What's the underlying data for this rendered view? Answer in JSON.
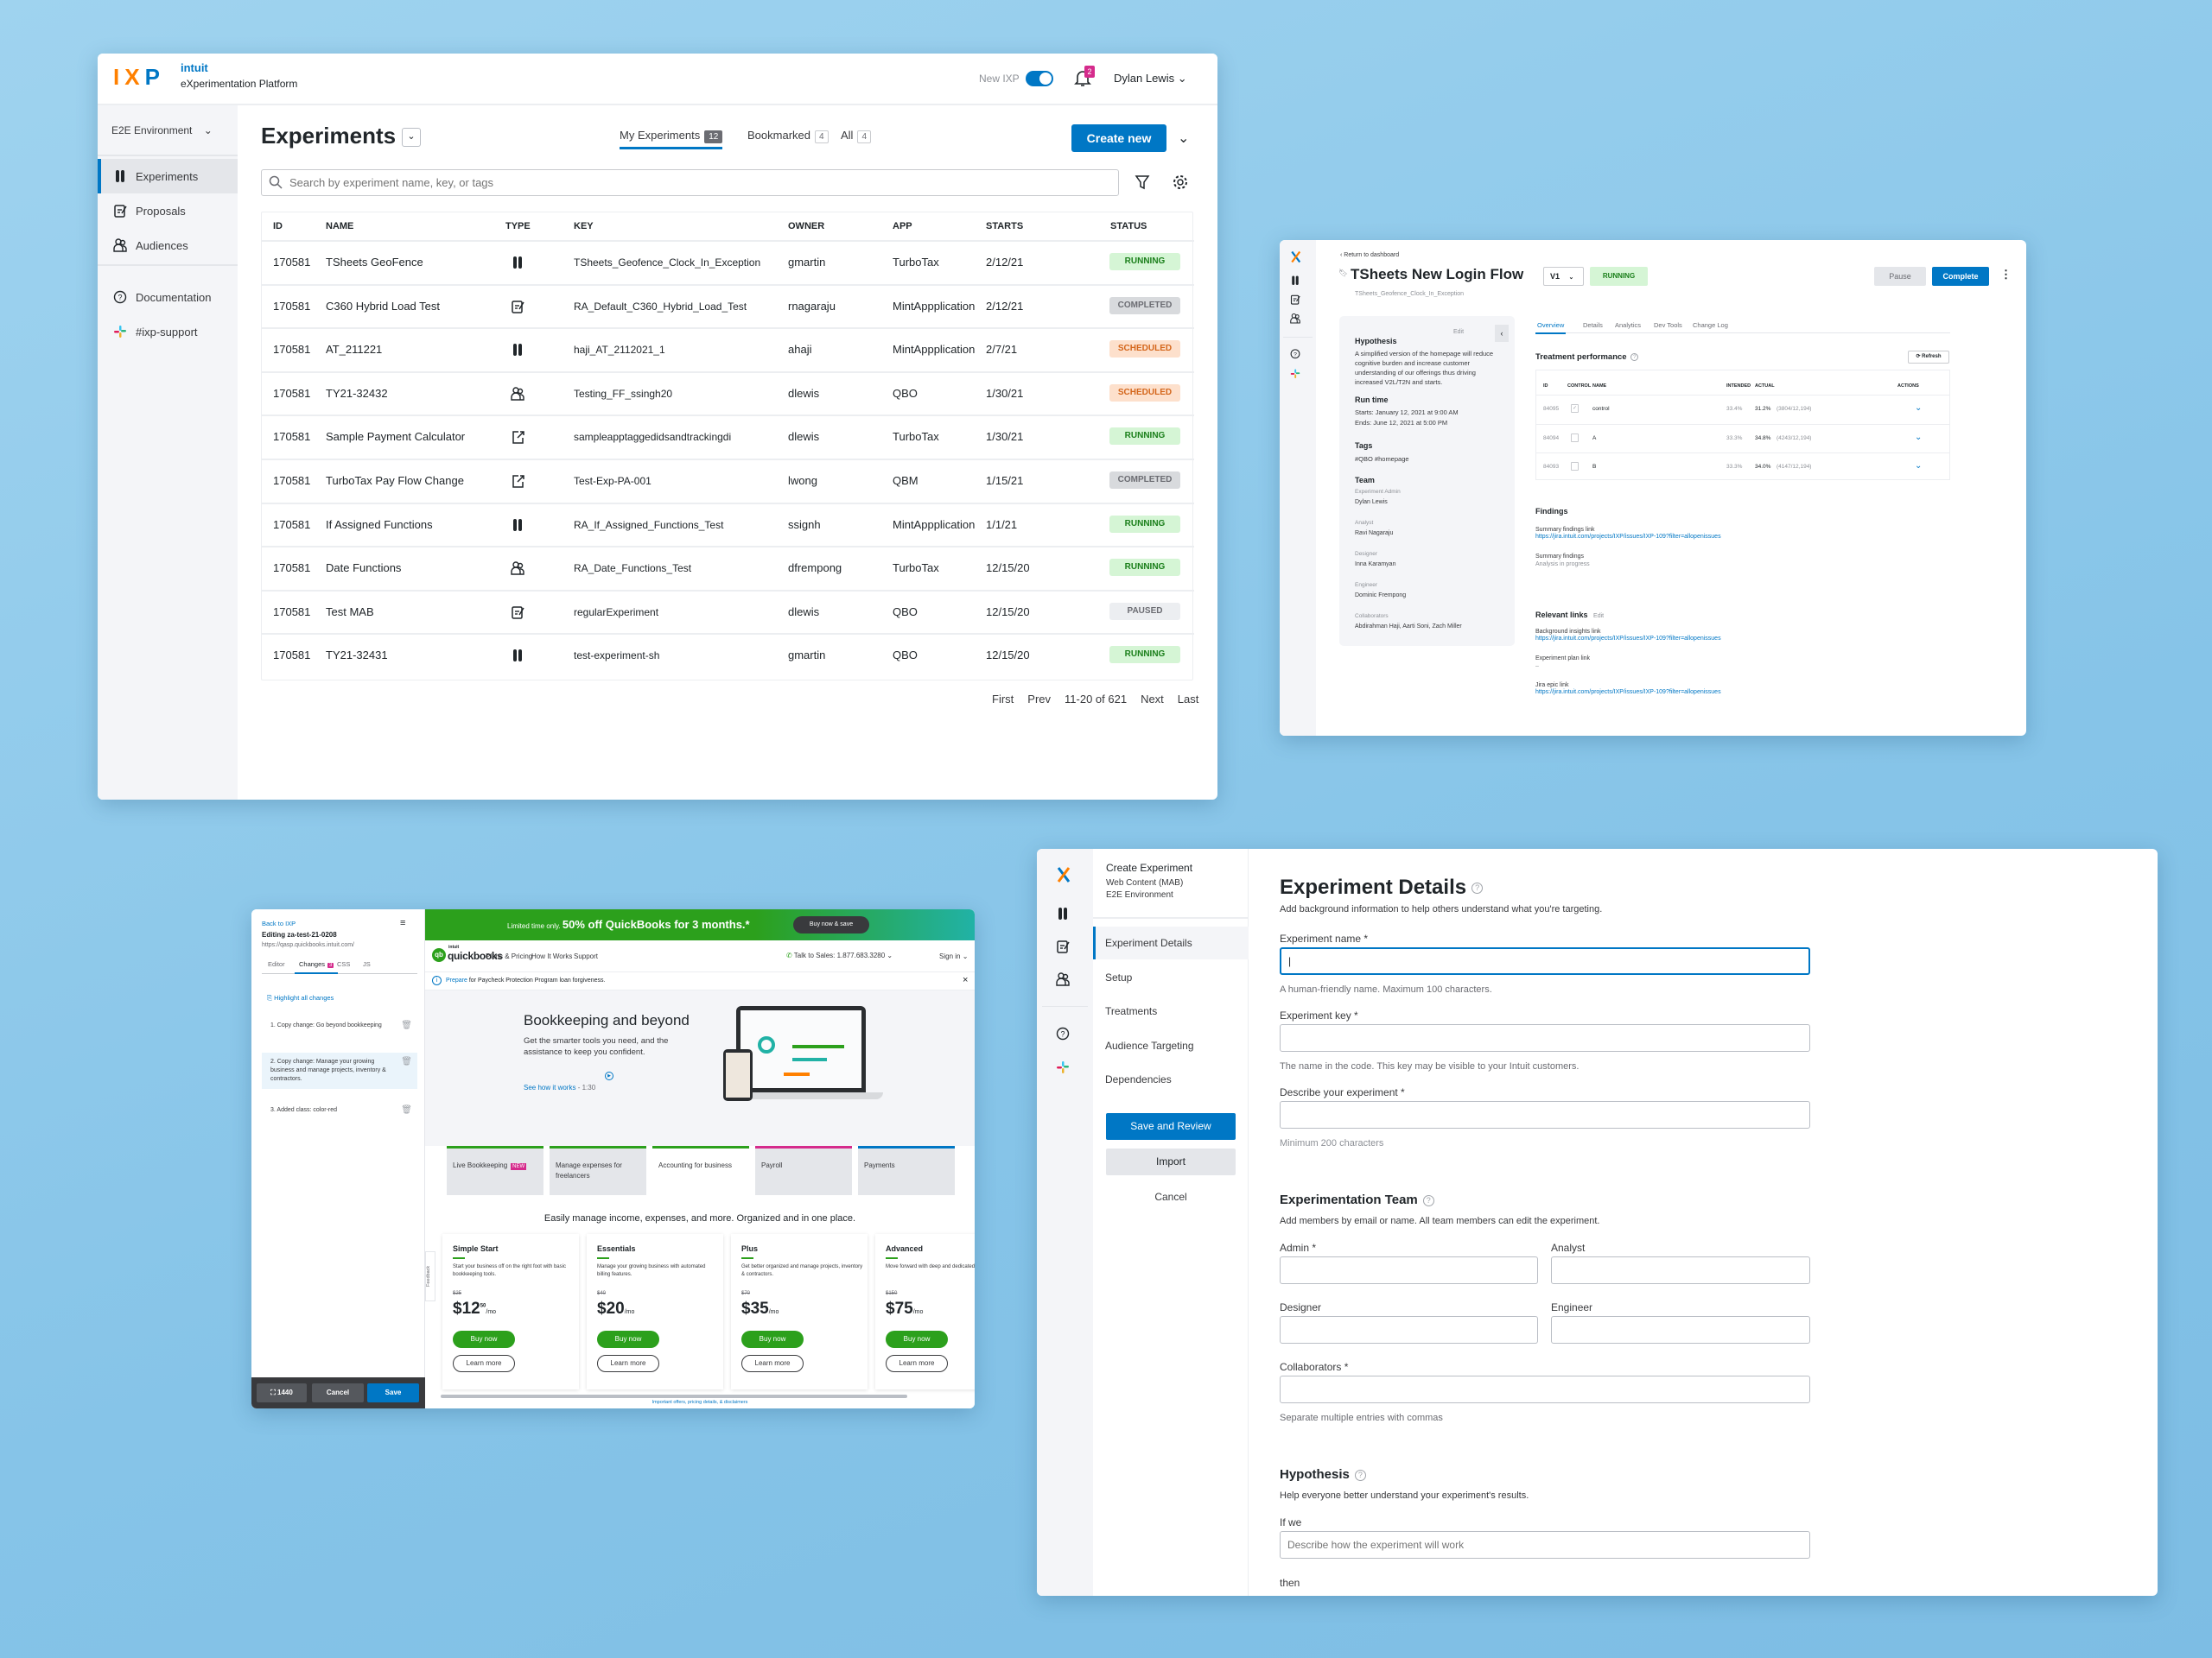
{
  "colors": {
    "brand_blue": "#0077c5",
    "running_bg": "#d5f5d5",
    "running_fg": "#1a7f1a",
    "completed_bg": "#d8dadd",
    "scheduled_bg": "#fde0cc",
    "scheduled_fg": "#d4661b",
    "paused_bg": "#eceef1",
    "qb_green": "#2ca01c",
    "background": "#8ecbea"
  },
  "ixp": {
    "logo": "IXP",
    "brand": "intuit",
    "platform": "eXperimentation Platform",
    "new_ixp_label": "New IXP",
    "new_ixp_on": true,
    "notifications": "2",
    "user": "Dylan Lewis",
    "environment": "E2E Environment",
    "sidebar": [
      {
        "label": "Experiments",
        "icon": "flask-icon"
      },
      {
        "label": "Proposals",
        "icon": "proposal-icon"
      },
      {
        "label": "Audiences",
        "icon": "audience-icon"
      },
      {
        "label": "Documentation",
        "icon": "help-icon"
      },
      {
        "label": "#ixp-support",
        "icon": "slack-icon"
      }
    ],
    "title": "Experiments",
    "tabs": [
      {
        "label": "My Experiments",
        "count": "12"
      },
      {
        "label": "Bookmarked",
        "count": "4"
      },
      {
        "label": "All",
        "count": "4"
      }
    ],
    "create_label": "Create new",
    "search_placeholder": "Search by experiment name, key, or tags",
    "columns": [
      "ID",
      "NAME",
      "TYPE",
      "KEY",
      "OWNER",
      "APP",
      "STARTS",
      "STATUS"
    ],
    "rows": [
      {
        "id": "170581",
        "name": "TSheets GeoFence",
        "type": "ab-test",
        "key": "TSheets_Geofence_Clock_In_Exception",
        "owner": "gmartin",
        "app": "TurboTax",
        "starts": "2/12/21",
        "status": "RUNNING"
      },
      {
        "id": "170581",
        "name": "C360 Hybrid Load Test",
        "type": "proposal",
        "key": "RA_Default_C360_Hybrid_Load_Test",
        "owner": "rnagaraju",
        "app": "MintAppplication",
        "starts": "2/12/21",
        "status": "COMPLETED"
      },
      {
        "id": "170581",
        "name": "AT_211221",
        "type": "ab-test",
        "key": "haji_AT_2112021_1",
        "owner": "ahaji",
        "app": "MintAppplication",
        "starts": "2/7/21",
        "status": "SCHEDULED"
      },
      {
        "id": "170581",
        "name": "TY21-32432",
        "type": "audience",
        "key": "Testing_FF_ssingh20",
        "owner": "dlewis",
        "app": "QBO",
        "starts": "1/30/21",
        "status": "SCHEDULED"
      },
      {
        "id": "170581",
        "name": "Sample Payment Calculator",
        "type": "external",
        "key": "sampleapptaggedidsandtrackingdi",
        "owner": "dlewis",
        "app": "TurboTax",
        "starts": "1/30/21",
        "status": "RUNNING"
      },
      {
        "id": "170581",
        "name": "TurboTax Pay Flow Change",
        "type": "external",
        "key": "Test-Exp-PA-001",
        "owner": "lwong",
        "app": "QBM",
        "starts": "1/15/21",
        "status": "COMPLETED"
      },
      {
        "id": "170581",
        "name": "If Assigned Functions",
        "type": "ab-test",
        "key": "RA_If_Assigned_Functions_Test",
        "owner": "ssignh",
        "app": "MintAppplication",
        "starts": "1/1/21",
        "status": "RUNNING"
      },
      {
        "id": "170581",
        "name": "Date Functions",
        "type": "audience",
        "key": "RA_Date_Functions_Test",
        "owner": "dfrempong",
        "app": "TurboTax",
        "starts": "12/15/20",
        "status": "RUNNING"
      },
      {
        "id": "170581",
        "name": "Test MAB",
        "type": "proposal",
        "key": "regularExperiment",
        "owner": "dlewis",
        "app": "QBO",
        "starts": "12/15/20",
        "status": "PAUSED"
      },
      {
        "id": "170581",
        "name": "TY21-32431",
        "type": "ab-test",
        "key": "test-experiment-sh",
        "owner": "gmartin",
        "app": "QBO",
        "starts": "12/15/20",
        "status": "RUNNING"
      }
    ],
    "pagination": {
      "first": "First",
      "prev": "Prev",
      "range": "11-20 of 621",
      "next": "Next",
      "last": "Last"
    }
  },
  "detail": {
    "back": "Return to dashboard",
    "title": "TSheets New Login Flow",
    "version": "V1",
    "status": "RUNNING",
    "key": "TSheets_Geofence_Clock_In_Exception",
    "pause": "Pause",
    "complete": "Complete",
    "edit": "Edit",
    "hypothesis_title": "Hypothesis",
    "hypothesis": "A simplified version of the homepage will reduce cognitive burden and increase customer understanding of our offerings thus driving increased V2L/T2N and starts.",
    "runtime_title": "Run time",
    "starts": "Starts:  January 12, 2021 at 9:00 AM",
    "ends": "Ends:  June 12, 2021 at 5:00 PM",
    "tags_title": "Tags",
    "tags": "#QBO #homepage",
    "team_title": "Team",
    "team": [
      {
        "role": "Experiment Admin",
        "name": "Dylan Lewis"
      },
      {
        "role": "Analyst",
        "name": "Ravi Nagaraju"
      },
      {
        "role": "Designer",
        "name": "Inna Karamyan"
      },
      {
        "role": "Engineer",
        "name": "Dominic Frempong"
      },
      {
        "role": "Collaborators",
        "name": "Abdirahman Haji, Aarti Soni, Zach Miller"
      }
    ],
    "tabs": [
      "Overview",
      "Details",
      "Analytics",
      "Dev Tools",
      "Change Log"
    ],
    "perf_title": "Treatment performance",
    "refresh": "Refresh",
    "perf_columns": [
      "ID",
      "CONTROL",
      "NAME",
      "INTENDED",
      "ACTUAL",
      "ACTIONS"
    ],
    "perf_rows": [
      {
        "id": "84095",
        "control": true,
        "name": "control",
        "intended": "33.4%",
        "actual": "31.2%",
        "ratio": "(3804/12,194)"
      },
      {
        "id": "84094",
        "control": false,
        "name": "A",
        "intended": "33.3%",
        "actual": "34.8%",
        "ratio": "(4243/12,194)"
      },
      {
        "id": "84093",
        "control": false,
        "name": "B",
        "intended": "33.3%",
        "actual": "34.0%",
        "ratio": "(4147/12,194)"
      }
    ],
    "findings_title": "Findings",
    "findings": [
      {
        "label": "Summary findings link",
        "value": "https://jira.intuit.com/projects/IXP/issues/IXP-109?filter=allopenissues",
        "link": true
      },
      {
        "label": "Summary findings",
        "value": "Analysis in progress",
        "link": false
      }
    ],
    "links_title": "Relevant links",
    "links_edit": "Edit",
    "links": [
      {
        "label": "Background insights link",
        "value": "https://jira.intuit.com/projects/IXP/issues/IXP-109?filter=allopenissues",
        "link": true
      },
      {
        "label": "Experiment plan link",
        "value": "–",
        "link": false
      },
      {
        "label": "Jira epic link",
        "value": "https://jira.intuit.com/projects/IXP/issues/IXP-109?filter=allopenissues",
        "link": true
      }
    ]
  },
  "editor": {
    "back": "Back to IXP",
    "editing": "Editing za-test-21-0208",
    "url": "https://qasp.quickbooks.intuit.com/",
    "tabs": [
      "Editor",
      "Changes",
      "CSS",
      "JS"
    ],
    "changes_count": "3",
    "highlight": "Highlight all changes",
    "changes": [
      "1.  Copy change: Go beyond bookkeeping",
      "2.  Copy change: Manage your growing business and manage projects, inventory & contractors.",
      "3.  Added class: color-red"
    ],
    "width": "1440",
    "cancel": "Cancel",
    "save": "Save",
    "site": {
      "promo_prefix": "Limited time only.",
      "promo": "50% off QuickBooks for 3 months.*",
      "promo_btn": "Buy now & save",
      "logo_small": "intuit",
      "logo": "quickbooks",
      "nav": [
        "Plans & Pricing",
        "How It Works",
        "Support"
      ],
      "sales": "Talk to Sales: 1.877.683.3280",
      "signin": "Sign in",
      "notice_link": "Prepare",
      "notice": " for Paycheck Protection Program loan forgiveness.",
      "hero_title": "Bookkeeping and beyond",
      "hero_text": "Get the smarter tools you need, and the assistance to keep you confident.",
      "hero_link": "See how it works",
      "hero_time": " - 1:30",
      "tabs": [
        {
          "label": "Live Bookkeeping",
          "badge": "NEW",
          "color": "#2ca01c"
        },
        {
          "label": "Manage expenses for freelancers",
          "color": "#2ca01c"
        },
        {
          "label": "Accounting for business",
          "color": "#2ca01c"
        },
        {
          "label": "Payroll",
          "color": "#d52b8c"
        },
        {
          "label": "Payments",
          "color": "#0077c5"
        }
      ],
      "headline": "Easily manage income, expenses, and more. Organized and in one place.",
      "feedback": "Feedback",
      "plans": [
        {
          "name": "Simple Start",
          "desc": "Start your business off on the right foot with basic bookkeeping tools.",
          "old": "$25",
          "price": "$12",
          "cents": "50",
          "per": "/mo"
        },
        {
          "name": "Essentials",
          "desc": "Manage your growing business with automated billing features.",
          "old": "$40",
          "price": "$20",
          "cents": "",
          "per": "/mo"
        },
        {
          "name": "Plus",
          "desc": "Get better organized and manage projects, inventory & contractors.",
          "old": "$70",
          "price": "$35",
          "cents": "",
          "per": "/mo"
        },
        {
          "name": "Advanced",
          "desc": "Move forward with deep and dedicated support.",
          "old": "$150",
          "price": "$75",
          "cents": "",
          "per": "/mo"
        }
      ],
      "buy": "Buy now",
      "learn": "Learn more",
      "disclaimer": "Important offers, pricing details, & disclaimers"
    }
  },
  "create": {
    "header": "Create Experiment",
    "subtype": "Web Content (MAB)",
    "env": "E2E Environment",
    "steps": [
      "Experiment Details",
      "Setup",
      "Treatments",
      "Audience Targeting",
      "Dependencies"
    ],
    "save": "Save and Review",
    "import": "Import",
    "cancel": "Cancel",
    "title": "Experiment Details",
    "desc": "Add background information to help others understand what you're targeting.",
    "name_label": "Experiment name *",
    "name_help": "A human-friendly name. Maximum 100 characters.",
    "key_label": "Experiment key *",
    "key_help": "The name in the code. This key may be visible to your Intuit customers.",
    "describe_label": "Describe your experiment *",
    "describe_help": "Minimum 200 characters",
    "team_title": "Experimentation Team",
    "team_desc": "Add members by email or name. All team members can edit the experiment.",
    "admin": "Admin *",
    "analyst": "Analyst",
    "designer": "Designer",
    "engineer": "Engineer",
    "collab": "Collaborators *",
    "collab_help": "Separate multiple entries with commas",
    "hyp_title": "Hypothesis",
    "hyp_desc": "Help everyone better understand your experiment's results.",
    "ifwe": "If we",
    "ifwe_placeholder": "Describe how the experiment will work",
    "then": "then"
  }
}
